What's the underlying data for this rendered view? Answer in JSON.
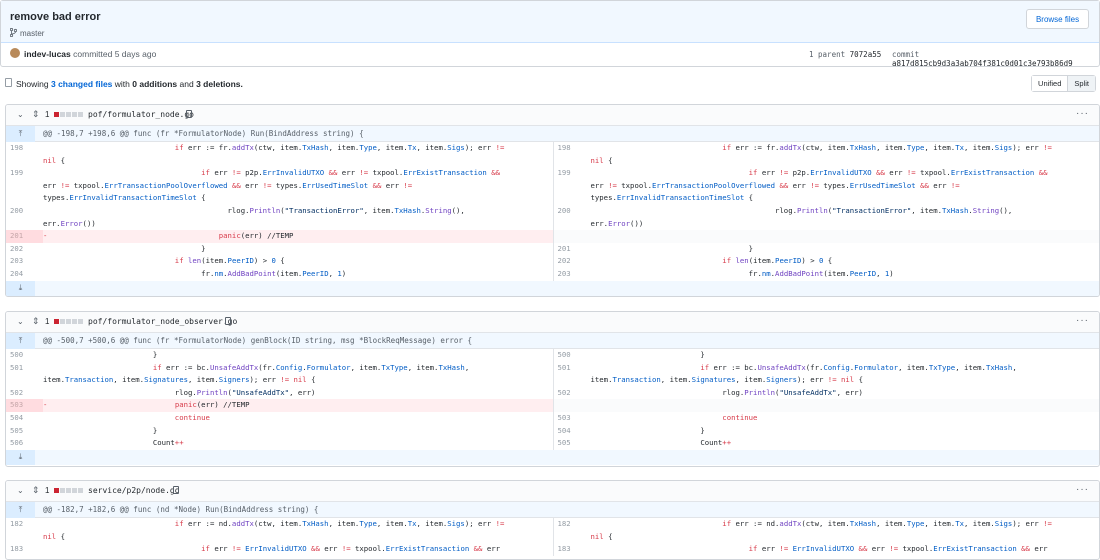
{
  "commit": {
    "title": "remove bad error",
    "branch": "master",
    "browse_files": "Browse files",
    "author": "indev-lucas",
    "committed": "committed 5 days ago",
    "parent_label": "1 parent",
    "parent_sha": "7072a55",
    "commit_label": "commit",
    "commit_sha": "a817d815cb9d3a3ab704f381c0d01c3e793b86d9"
  },
  "summary": {
    "showing": "Showing",
    "changed_files": "3 changed files",
    "with": "with",
    "additions": "0 additions",
    "and": "and",
    "deletions": "3 deletions.",
    "unified": "Unified",
    "split": "Split"
  },
  "files": [
    {
      "count": "1",
      "path": "pof/formulator_node.go",
      "hunk": "@@ -198,7 +198,6 @@ func (fr *FormulatorNode) Run(BindAddress string) {"
    },
    {
      "count": "1",
      "path": "pof/formulator_node_observer.go",
      "hunk": "@@ -500,7 +500,6 @@ func (fr *FormulatorNode) genBlock(ID string, msg *BlockReqMessage) error {"
    },
    {
      "count": "1",
      "path": "service/p2p/node.go",
      "hunk": "@@ -182,7 +182,6 @@ func (nd *Node) Run(BindAddress string) {"
    }
  ],
  "icons": {
    "chevron": "chevron-down-icon",
    "expand": "unfold-icon",
    "clipboard": "clipboard-icon",
    "more": "kebab-horizontal-icon",
    "branch": "git-branch-icon",
    "file": "file-diff-icon"
  }
}
